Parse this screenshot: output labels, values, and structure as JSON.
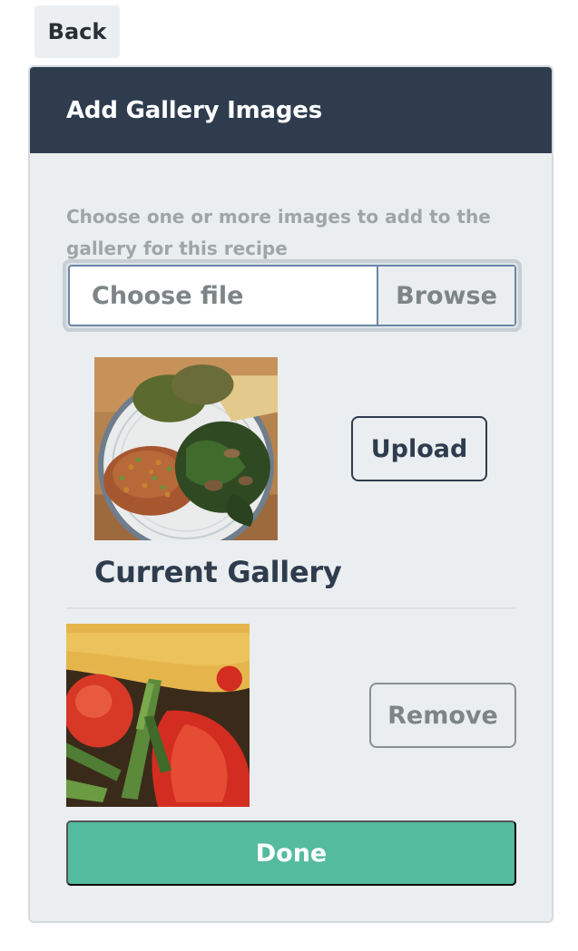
{
  "back_label": "Back",
  "modal": {
    "title": "Add Gallery Images",
    "help_text": "Choose one or more images to add to the gallery for this recipe",
    "file_input": {
      "placeholder": "Choose file",
      "browse_label": "Browse"
    },
    "upload_label": "Upload",
    "current_gallery_heading": "Current Gallery",
    "remove_label": "Remove",
    "done_label": "Done"
  },
  "colors": {
    "header_bg": "#2e3c4e",
    "card_bg": "#ebeef0",
    "done_green": "#55bb9e",
    "muted_text": "#9fa6a8"
  },
  "images": {
    "preview": "photo-of-plate-with-lentils-greens-and-grain-salad",
    "gallery": [
      "photo-of-omelette-with-tomato-and-asparagus"
    ]
  }
}
